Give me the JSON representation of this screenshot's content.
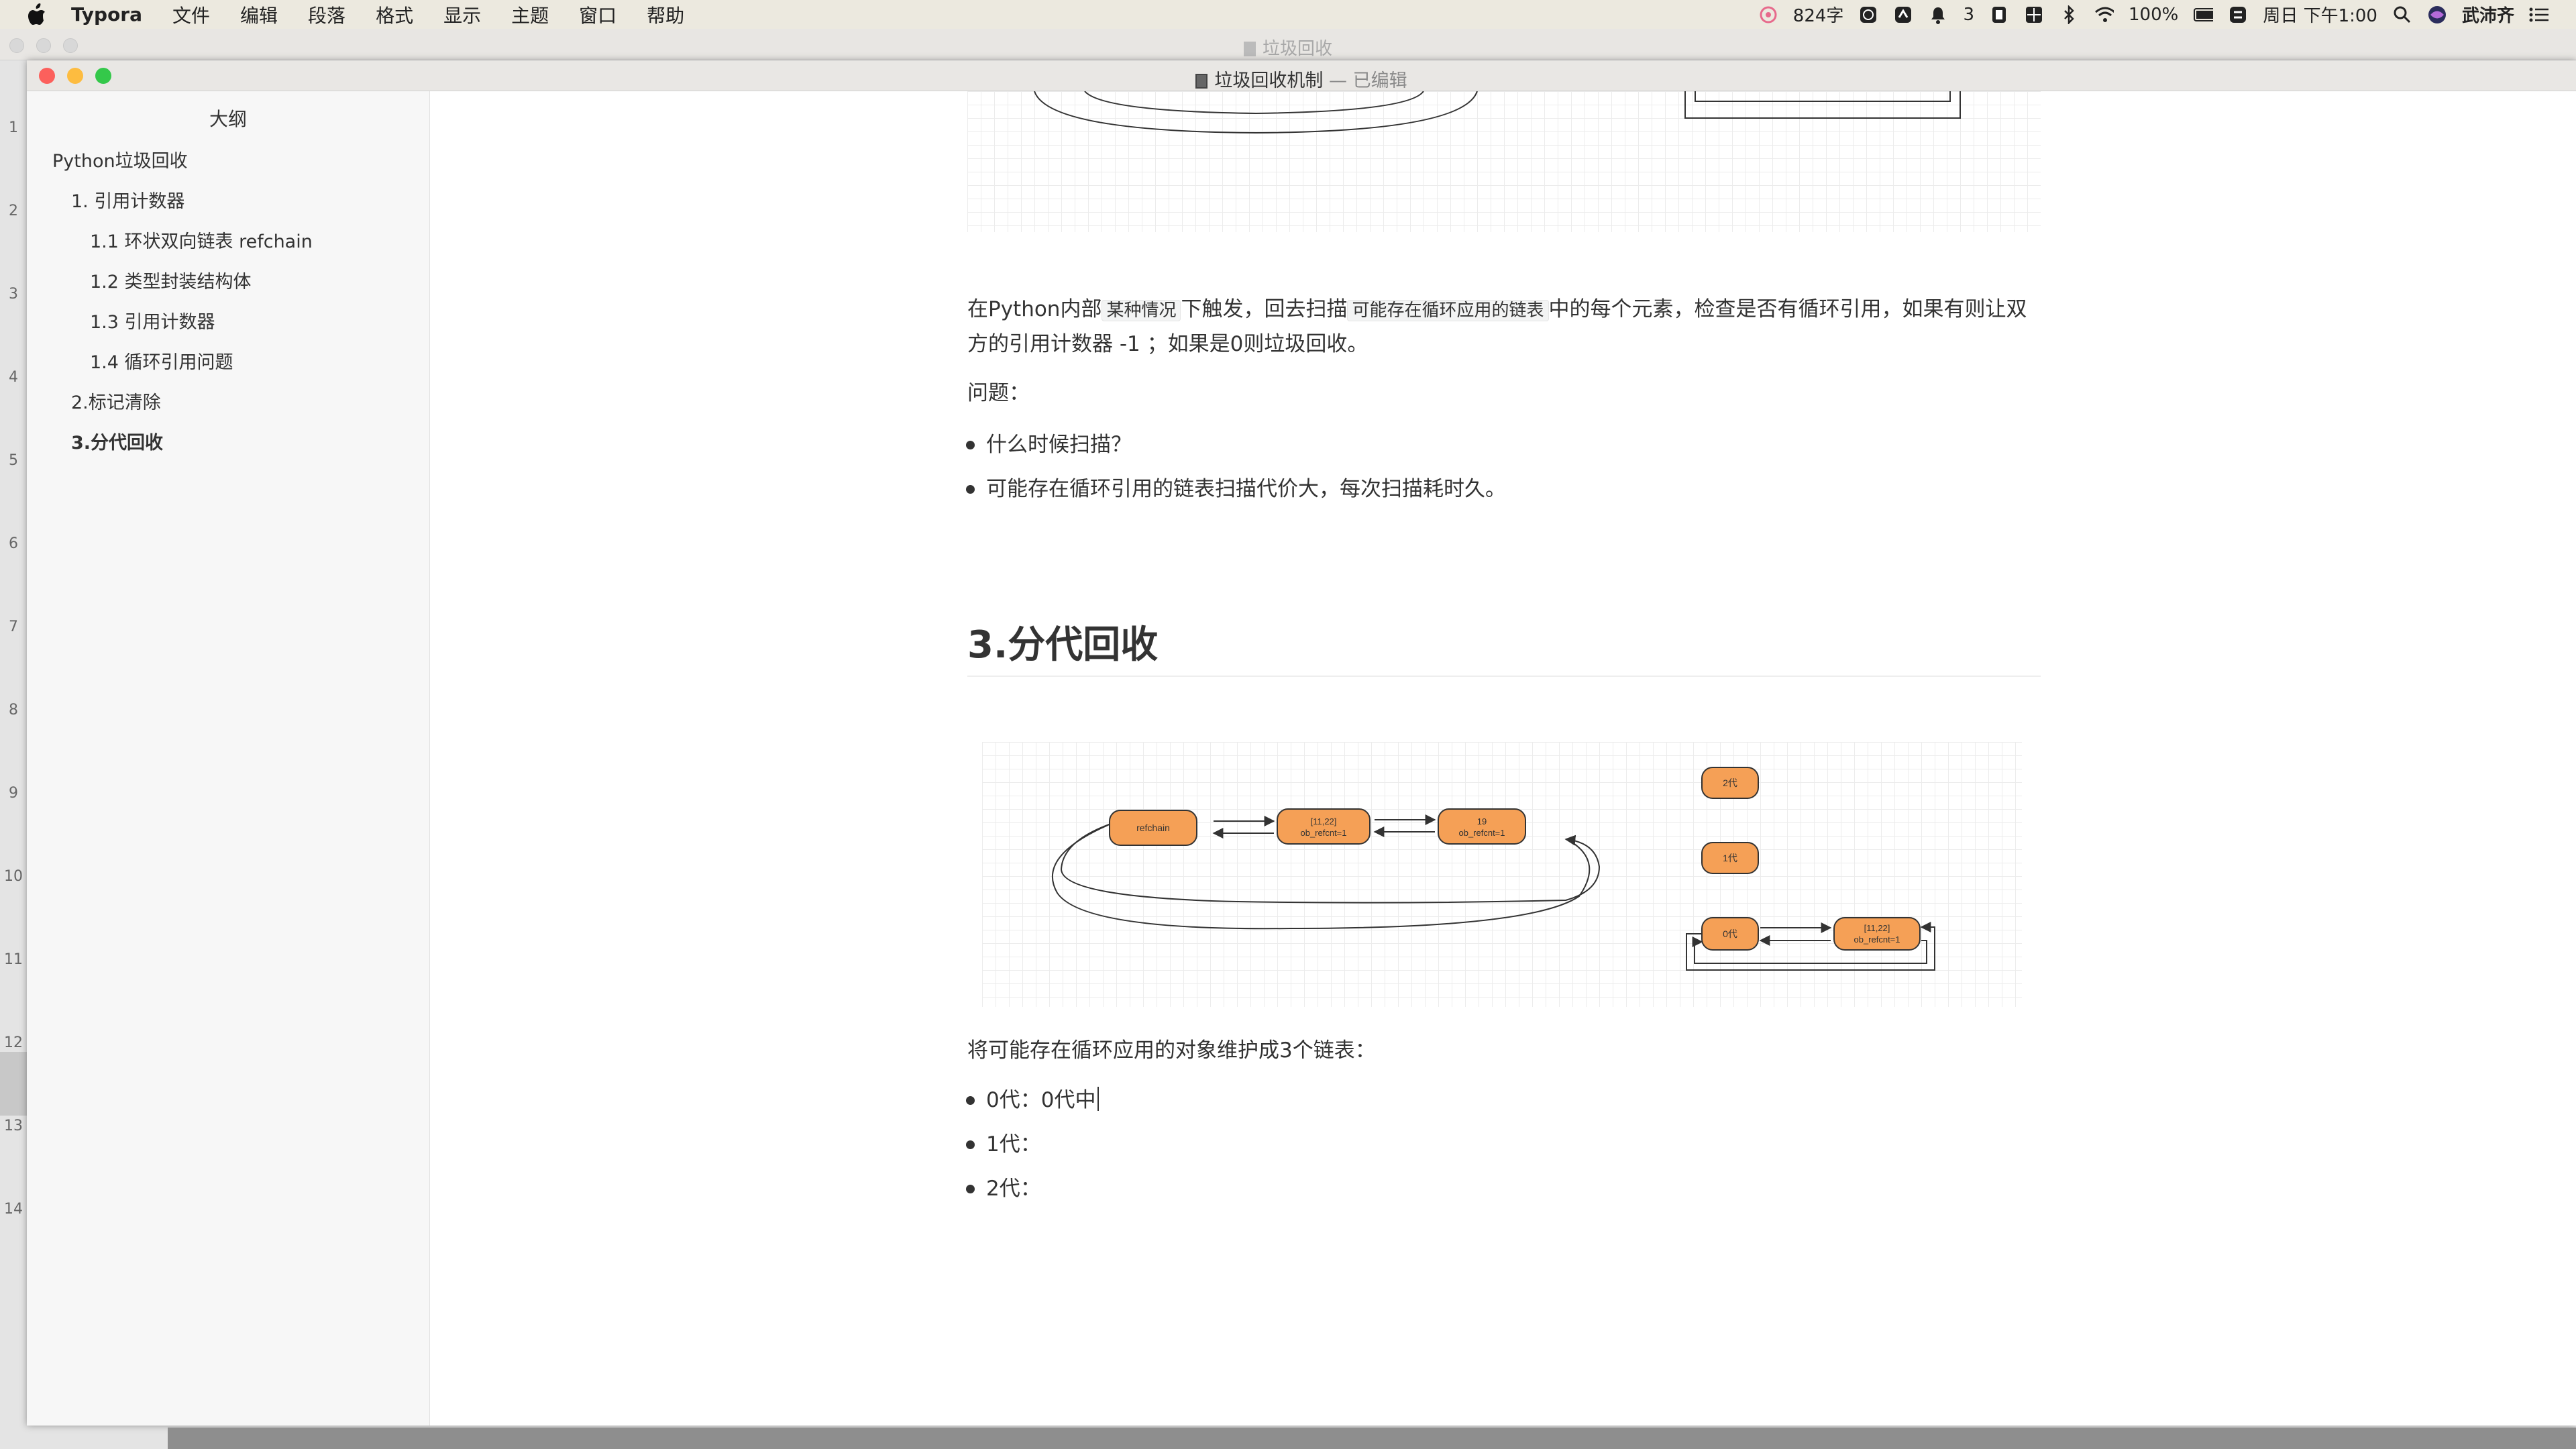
{
  "menubar": {
    "app": "Typora",
    "items": [
      "文件",
      "编辑",
      "段落",
      "格式",
      "显示",
      "主题",
      "窗口",
      "帮助"
    ],
    "word_count": "824字",
    "notifications": "3",
    "battery": "100%",
    "clock": "周日 下午1:00",
    "user": "武沛齐"
  },
  "bg_window": {
    "title": "垃圾回收"
  },
  "window": {
    "title": "垃圾回收机制",
    "state": "— 已编辑"
  },
  "sidebar": {
    "title": "大纲",
    "items": [
      {
        "label": "Python垃圾回收",
        "level": 1,
        "active": false
      },
      {
        "label": "1. 引用计数器",
        "level": 2,
        "active": false
      },
      {
        "label": "1.1 环状双向链表 refchain",
        "level": 3,
        "active": false
      },
      {
        "label": "1.2 类型封装结构体",
        "level": 3,
        "active": false
      },
      {
        "label": "1.3 引用计数器",
        "level": 3,
        "active": false
      },
      {
        "label": "1.4 循环引用问题",
        "level": 3,
        "active": false
      },
      {
        "label": "2.标记清除",
        "level": 2,
        "active": false
      },
      {
        "label": "3.分代回收",
        "level": 2,
        "active": true
      }
    ]
  },
  "gutter": {
    "lines": [
      "1",
      "2",
      "3",
      "4",
      "5",
      "6",
      "7",
      "8",
      "9",
      "10",
      "11",
      "12",
      "13",
      "14"
    ]
  },
  "doc": {
    "para1": {
      "pre": "在Python内部",
      "code1": "某种情况",
      "mid": "下触发，回去扫描",
      "code2": "可能存在循环应用的链表",
      "post": "中的每个元素，检查是否有循环引用，如果有则让双方的引用计数器 -1 ；如果是0则垃圾回收。"
    },
    "question_label": "问题：",
    "questions": [
      "什么时候扫描？",
      "可能存在循环引用的链表扫描代价大，每次扫描耗时久。"
    ],
    "heading": "3.分代回收",
    "para2": "将可能存在循环应用的对象维护成3个链表：",
    "generations": [
      "0代：0代中",
      "1代：",
      "2代："
    ]
  },
  "diagram": {
    "nodes": {
      "refchain": "refchain",
      "list1": [
        "[11,22]",
        "ob_refcnt=1"
      ],
      "int19": [
        "19",
        "ob_refcnt=1"
      ],
      "gen2": "2代",
      "gen1": "1代",
      "gen0": "0代",
      "list2": [
        "[11,22]",
        "ob_refcnt=1"
      ]
    },
    "node_fill": "#f5a056",
    "node_stroke": "#333333"
  },
  "colors": {
    "close": "#fc605c",
    "minimize": "#fdbc40",
    "zoom": "#34c84a"
  }
}
